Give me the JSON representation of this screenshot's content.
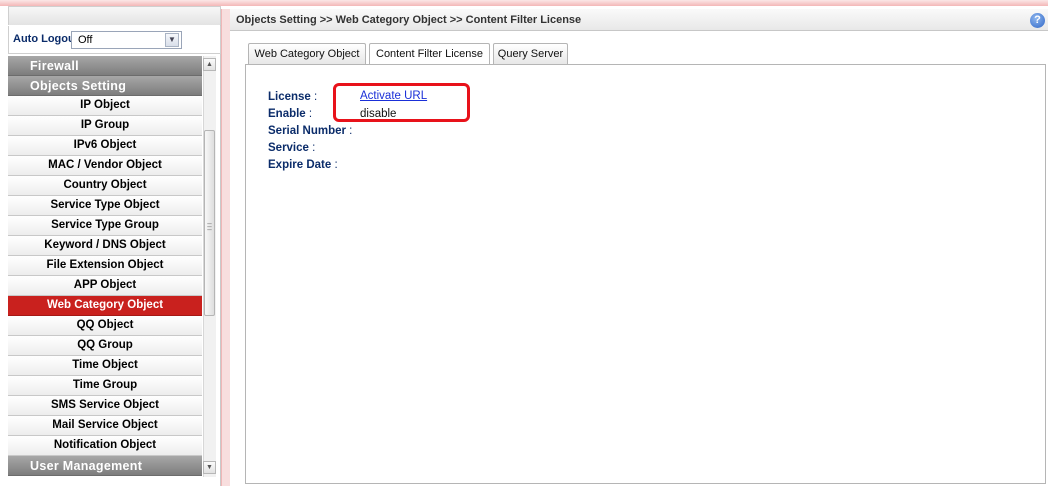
{
  "sidebar": {
    "auto_logout_label": "Auto Logout :",
    "auto_logout_value": "Off",
    "items": [
      {
        "label": "Firewall",
        "type": "category"
      },
      {
        "label": "Objects Setting",
        "type": "category"
      },
      {
        "label": "IP Object",
        "type": "item"
      },
      {
        "label": "IP Group",
        "type": "item"
      },
      {
        "label": "IPv6 Object",
        "type": "item"
      },
      {
        "label": "MAC / Vendor Object",
        "type": "item"
      },
      {
        "label": "Country Object",
        "type": "item"
      },
      {
        "label": "Service Type Object",
        "type": "item"
      },
      {
        "label": "Service Type Group",
        "type": "item"
      },
      {
        "label": "Keyword / DNS Object",
        "type": "item"
      },
      {
        "label": "File Extension Object",
        "type": "item"
      },
      {
        "label": "APP Object",
        "type": "item"
      },
      {
        "label": "Web Category Object",
        "type": "item",
        "active": true
      },
      {
        "label": "QQ Object",
        "type": "item"
      },
      {
        "label": "QQ Group",
        "type": "item"
      },
      {
        "label": "Time Object",
        "type": "item"
      },
      {
        "label": "Time Group",
        "type": "item"
      },
      {
        "label": "SMS Service Object",
        "type": "item"
      },
      {
        "label": "Mail Service Object",
        "type": "item"
      },
      {
        "label": "Notification Object",
        "type": "item"
      },
      {
        "label": "User Management",
        "type": "category"
      }
    ]
  },
  "header": {
    "breadcrumb": "Objects Setting >> Web Category Object >> Content Filter License",
    "help_icon": "help-icon"
  },
  "tabs": [
    {
      "label": "Web Category Object"
    },
    {
      "label": "Content Filter License",
      "selected": true
    },
    {
      "label": "Query Server"
    }
  ],
  "fields": [
    {
      "label": "License",
      "value": "Activate URL",
      "is_link": true
    },
    {
      "label": "Enable",
      "value": "disable"
    },
    {
      "label": "Serial Number",
      "value": ""
    },
    {
      "label": "Service",
      "value": ""
    },
    {
      "label": "Expire Date",
      "value": ""
    }
  ],
  "colors": {
    "active_menu": "#c9211e",
    "label_text": "#0b2c6a",
    "link": "#1a2fd8",
    "highlight": "#e8121a"
  }
}
